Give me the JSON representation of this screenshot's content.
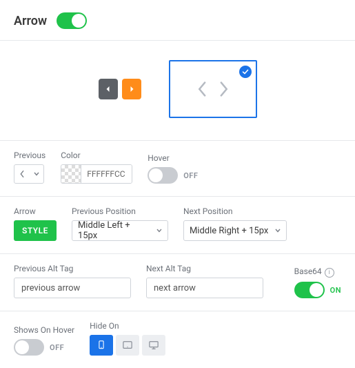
{
  "header": {
    "title": "Arrow",
    "enabled_toggle": "on"
  },
  "row1": {
    "previous_label": "Previous",
    "color_label": "Color",
    "color_value": "FFFFFFCC",
    "hover_label": "Hover",
    "hover_toggle": "off",
    "hover_toggle_text": "OFF"
  },
  "row2": {
    "arrow_label": "Arrow",
    "style_btn": "STYLE",
    "prev_pos_label": "Previous Position",
    "prev_pos_value": "Middle Left + 15px",
    "next_pos_label": "Next Position",
    "next_pos_value": "Middle Right + 15px"
  },
  "row3": {
    "prev_alt_label": "Previous Alt Tag",
    "prev_alt_value": "previous arrow",
    "next_alt_label": "Next Alt Tag",
    "next_alt_value": "next arrow",
    "base64_label": "Base64",
    "base64_toggle": "on",
    "base64_toggle_text": "ON"
  },
  "row4": {
    "shows_label": "Shows On Hover",
    "shows_toggle": "off",
    "shows_toggle_text": "OFF",
    "hide_label": "Hide On"
  }
}
